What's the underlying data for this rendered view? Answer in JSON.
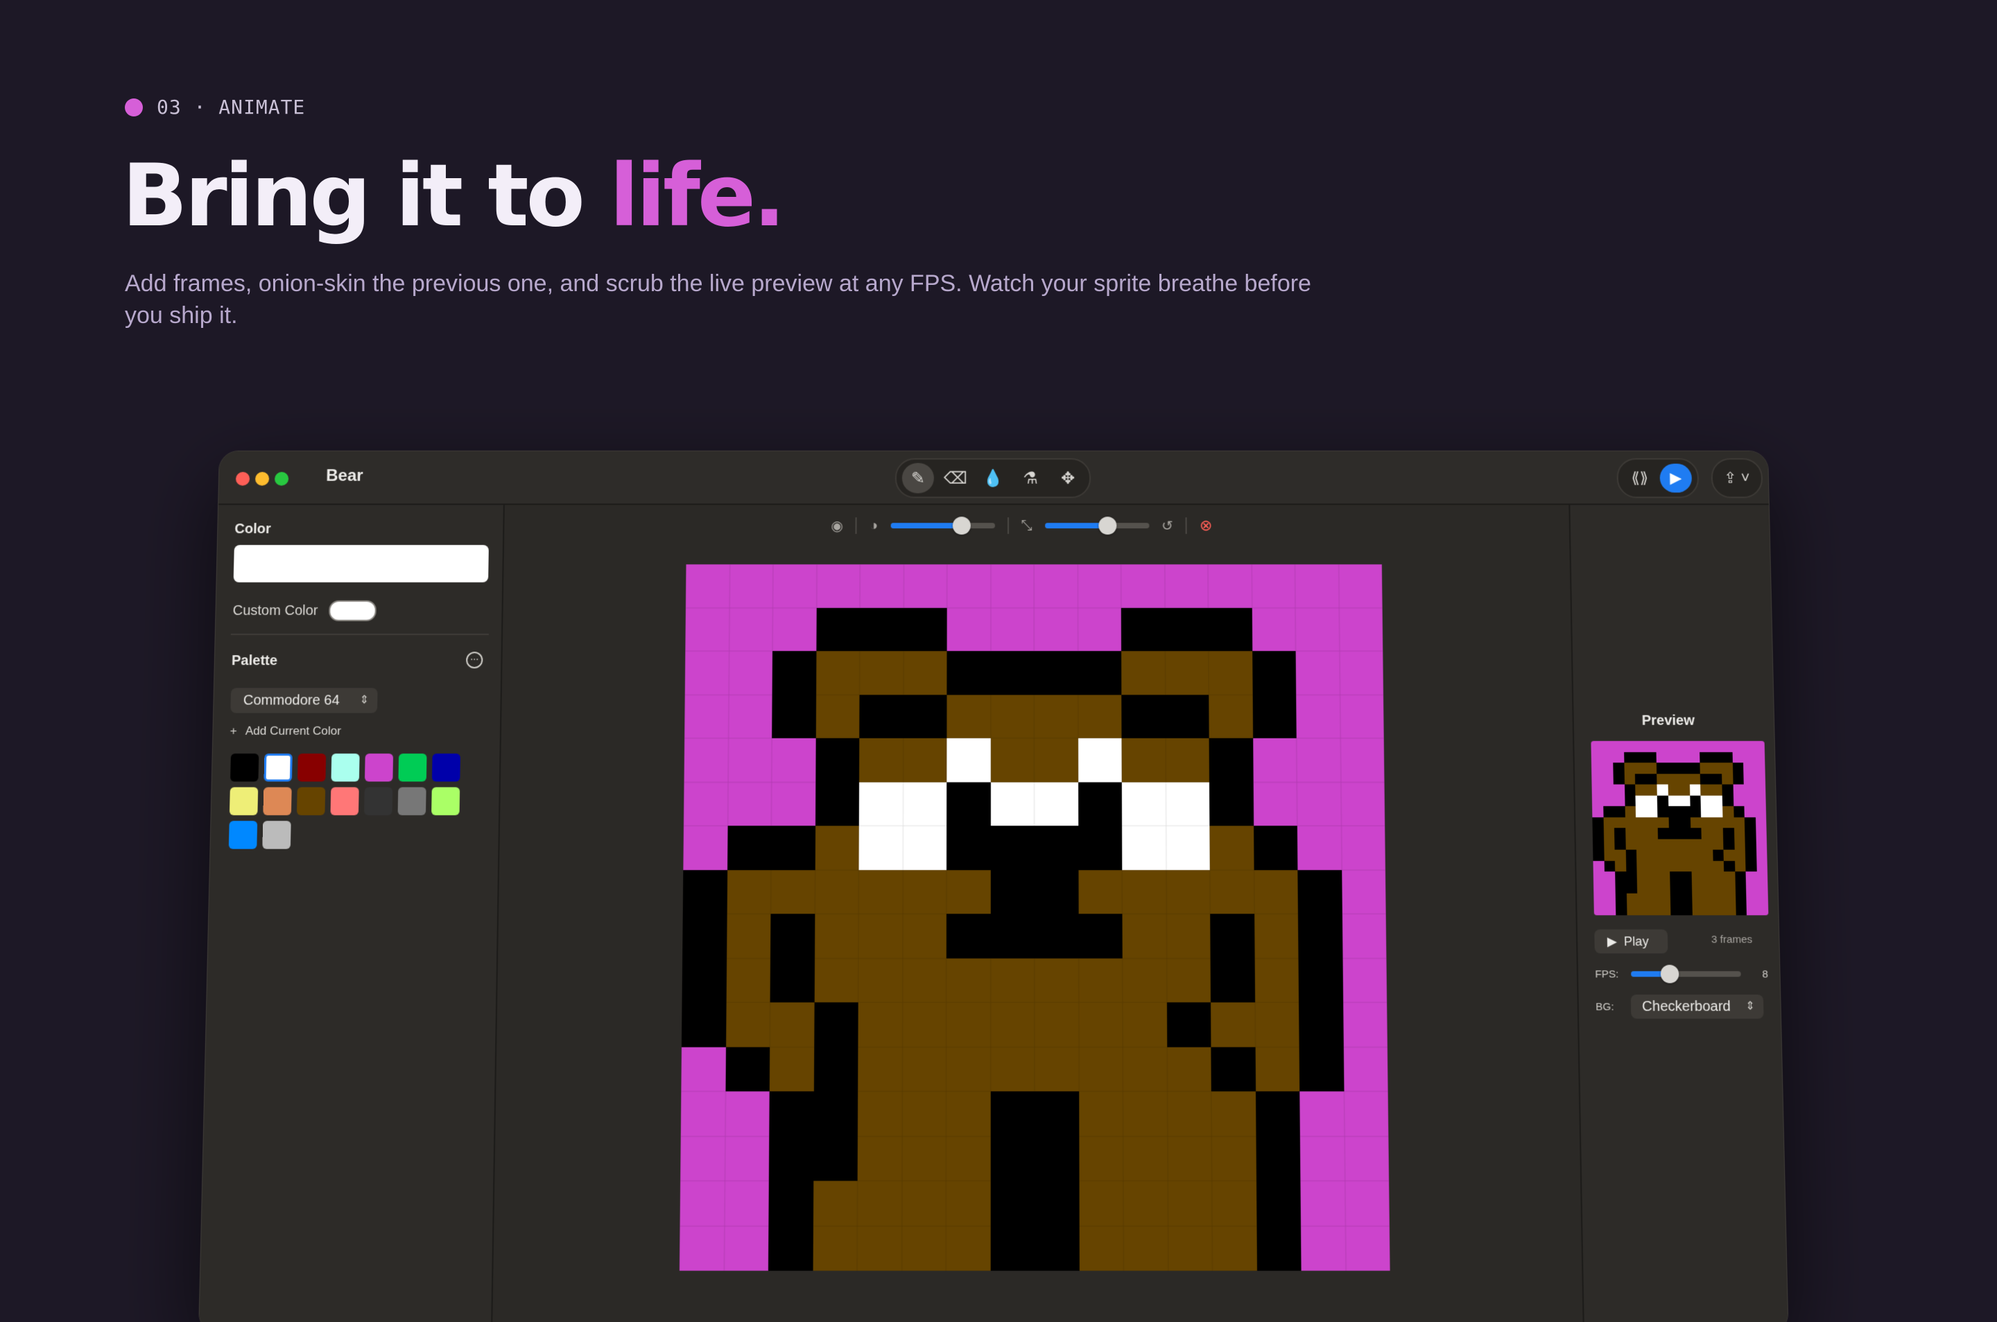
{
  "hero": {
    "eyebrow": "03 · ANIMATE",
    "headline_main": "Bring it to ",
    "headline_accent": "life.",
    "subtitle": "Add frames, onion-skin the previous one, and scrub the live preview at any FPS. Watch your sprite breathe before you ship it."
  },
  "colors": {
    "background": "#1d1826",
    "accent": "#d65fd8",
    "selection_blue": "#1f7cf2"
  },
  "window": {
    "title": "Bear",
    "tools": [
      {
        "name": "pencil-icon",
        "glyph": "✎",
        "active": true
      },
      {
        "name": "eraser-icon",
        "glyph": "⌫",
        "active": false
      },
      {
        "name": "fill-icon",
        "glyph": "💧",
        "active": false
      },
      {
        "name": "eyedropper-icon",
        "glyph": "⚗",
        "active": false
      },
      {
        "name": "move-icon",
        "glyph": "✥",
        "active": false
      }
    ]
  },
  "sidebar": {
    "color_label": "Color",
    "custom_color_label": "Custom Color",
    "palette_label": "Palette",
    "palette_selected": "Commodore 64",
    "add_current_color": "Add Current Color",
    "swatches": [
      "#000000",
      "#ffffff",
      "#880000",
      "#aaffee",
      "#cc44cc",
      "#00cc55",
      "#0000aa",
      "#eeee77",
      "#dd8855",
      "#664400",
      "#ff7777",
      "#333333",
      "#777777",
      "#aaff66",
      "#0088ff",
      "#bbbbbb"
    ],
    "selected_swatch": 1
  },
  "canvas_toolbar": {
    "onion_opacity": 0.68,
    "zoom": 0.6
  },
  "canvas": {
    "palette": {
      "M": "#cc44cc",
      "K": "#000000",
      "B": "#664400",
      "W": "#ffffff"
    },
    "rows": [
      "MMMMMMMMMMMMMMMM",
      "MMMKKKMMMMKKKMMM",
      "MMKBBBKKKKBBBKMM",
      "MMKBKKBBBBKKBKMM",
      "MMMKBBWBBWBBKMMM",
      "MMMKWWKWWKWWKMMM",
      "MKKBWWKKKKWWBKMM",
      "KBBBBBBKKBBBBBKM",
      "KBKBBBKKKKBBKBKM",
      "KBKBBBBBBBBBKBKM",
      "KBBKBBBBBBBKBBKM",
      "MKBKBBBBBBBBKBKM",
      "MMKKBBBKKBBBBKMM",
      "MMKKBBBKKBBBBKMM",
      "MMKBBBBKKBBBBKMM",
      "MMKBBBBKKBBBBKMM"
    ]
  },
  "preview": {
    "title": "Preview",
    "play_label": "Play",
    "frames_label": "3 frames",
    "fps_label": "FPS:",
    "fps_value": "8",
    "fps_slider": 0.35,
    "bg_label": "BG:",
    "bg_value": "Checkerboard"
  }
}
